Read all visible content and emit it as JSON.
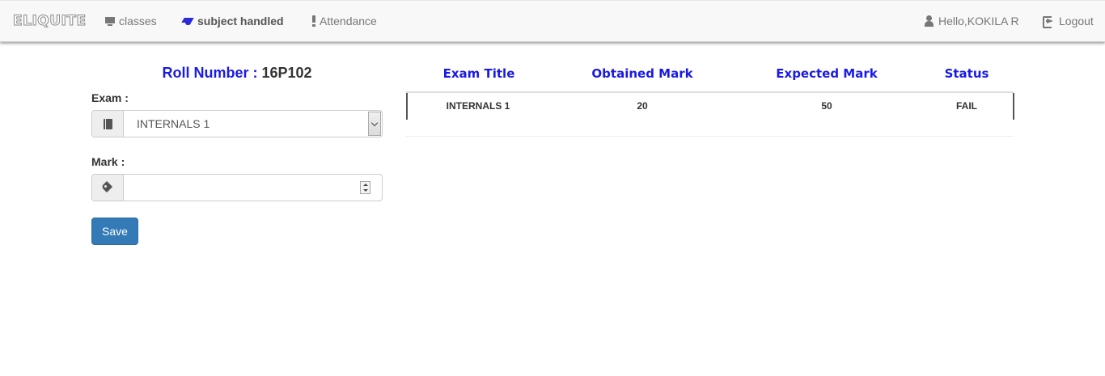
{
  "navbar": {
    "brand": "ELIQUITE",
    "items": [
      {
        "label": "classes",
        "icon": "monitor-icon"
      },
      {
        "label": "subject handled",
        "icon": "graduation-cap-icon"
      },
      {
        "label": "Attendance",
        "icon": "exclamation-icon"
      }
    ],
    "greeting": "Hello,KOKILA R",
    "logout": "Logout"
  },
  "form": {
    "roll_label": "Roll Number : ",
    "roll_number": "16P102",
    "exam_label": "Exam :",
    "exam_selected": "INTERNALS 1",
    "mark_label": "Mark :",
    "mark_value": "",
    "save_label": "Save"
  },
  "table": {
    "headers": [
      "Exam Title",
      "Obtained Mark",
      "Expected Mark",
      "Status"
    ],
    "rows": [
      {
        "exam_title": "INTERNALS 1",
        "obtained": "20",
        "expected": "50",
        "status": "FAIL"
      }
    ]
  },
  "colors": {
    "accent_blue": "#1a1ae6",
    "button_primary": "#337ab7",
    "navbar_bg": "#f8f8f8"
  }
}
